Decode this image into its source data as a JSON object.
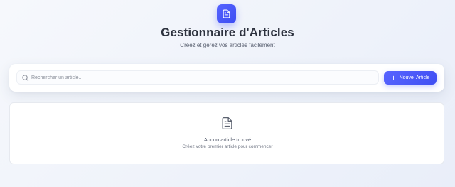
{
  "header": {
    "logo_icon": "document-icon",
    "title": "Gestionnaire d'Articles",
    "subtitle": "Créez et gérez vos articles facilement"
  },
  "toolbar": {
    "search": {
      "icon": "search-icon",
      "placeholder": "Rechercher un article...",
      "value": ""
    },
    "new_article_button": {
      "icon": "plus-icon",
      "label": "Nouvel Article"
    }
  },
  "empty_state": {
    "icon": "document-icon",
    "title": "Aucun article trouvé",
    "subtitle": "Créez votre premier article pour commencer"
  },
  "colors": {
    "accent": "#4a57fb",
    "background": "#f2f5fb",
    "card": "#ffffff",
    "text_primary": "#2d323e",
    "text_secondary": "#596070"
  }
}
